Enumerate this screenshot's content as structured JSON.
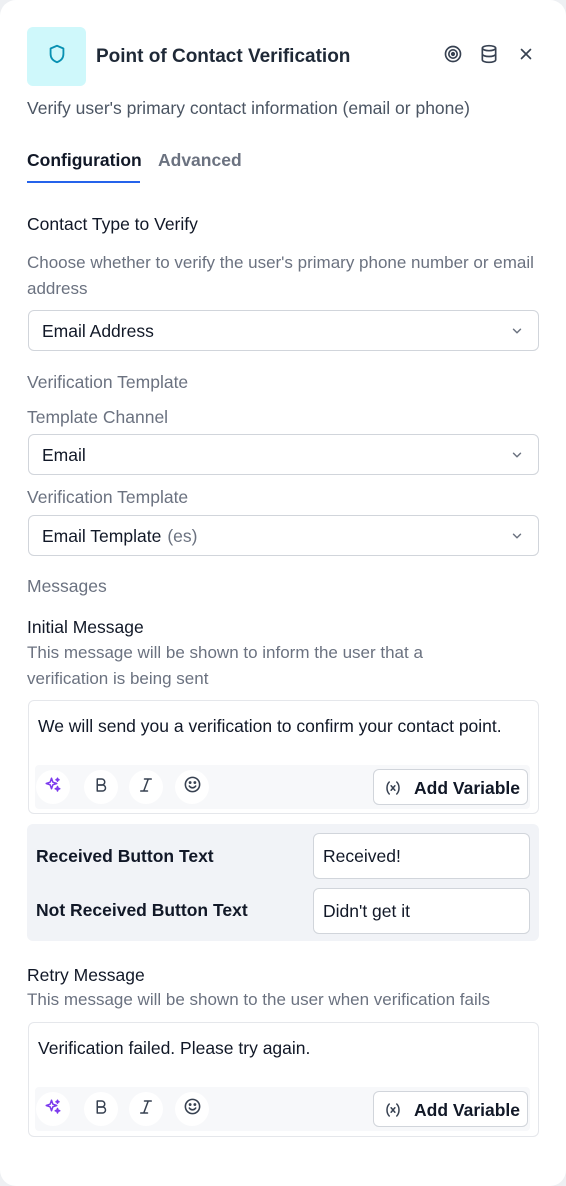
{
  "header": {
    "title": "Point of Contact Verification",
    "subtitle": "Verify user's primary contact information (email or phone)",
    "icon": "shield-icon",
    "actions": [
      "target-icon",
      "database-icon",
      "close-icon"
    ],
    "icon_bg": "#cff8fb",
    "icon_color": "#0891b2"
  },
  "tabs": [
    {
      "label": "Configuration",
      "active": true
    },
    {
      "label": "Advanced",
      "active": false
    }
  ],
  "contact_type": {
    "label": "Contact Type to Verify",
    "help": "Choose whether to verify the user's primary phone number or email address",
    "value": "Email Address"
  },
  "template_section": {
    "heading": "Verification Template",
    "channel_label": "Template Channel",
    "channel_value": "Email",
    "template_label": "Verification Template",
    "template_value": "Email Template",
    "template_lang": "(es)"
  },
  "messages": {
    "heading": "Messages",
    "initial": {
      "label": "Initial Message",
      "help": "This message will be shown to inform the user that a verification is being sent",
      "value": "We will send you a verification to confirm your contact point."
    },
    "buttons": {
      "received_label": "Received Button Text",
      "received_value": "Received!",
      "not_received_label": "Not Received Button Text",
      "not_received_value": "Didn't get it"
    },
    "retry": {
      "label": "Retry Message",
      "help": "This message will be shown to the user when verification fails",
      "value": "Verification failed. Please try again."
    }
  },
  "toolbar": {
    "add_variable": "Add Variable",
    "icons": [
      "sparkles-icon",
      "bold-icon",
      "italic-icon",
      "emoji-icon",
      "variable-icon"
    ],
    "accent": "#7c3aed"
  },
  "accent_color": "#2563eb"
}
